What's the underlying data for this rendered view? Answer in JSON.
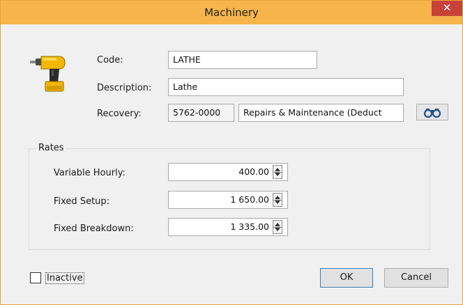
{
  "window": {
    "title": "Machinery",
    "close_glyph": "✕"
  },
  "icons": {
    "machine": "cordless-drill-icon",
    "lookup": "binoculars-icon"
  },
  "form": {
    "code_label": "Code:",
    "code_value": "LATHE",
    "description_label": "Description:",
    "description_value": "Lathe",
    "recovery_label": "Recovery:",
    "recovery_code": "5762-0000",
    "recovery_name": "Repairs & Maintenance (Deduct"
  },
  "rates": {
    "group_label": "Rates",
    "variable_hourly_label": "Variable Hourly:",
    "variable_hourly_value": "400.00",
    "fixed_setup_label": "Fixed Setup:",
    "fixed_setup_value": "1 650.00",
    "fixed_breakdown_label": "Fixed Breakdown:",
    "fixed_breakdown_value": "1 335.00"
  },
  "footer": {
    "inactive_label": "Inactive",
    "inactive_checked": false,
    "ok_label": "OK",
    "cancel_label": "Cancel"
  },
  "colors": {
    "titlebar": "#f6b44a",
    "close": "#c7433a",
    "default_button_border": "#3c7fb1"
  }
}
